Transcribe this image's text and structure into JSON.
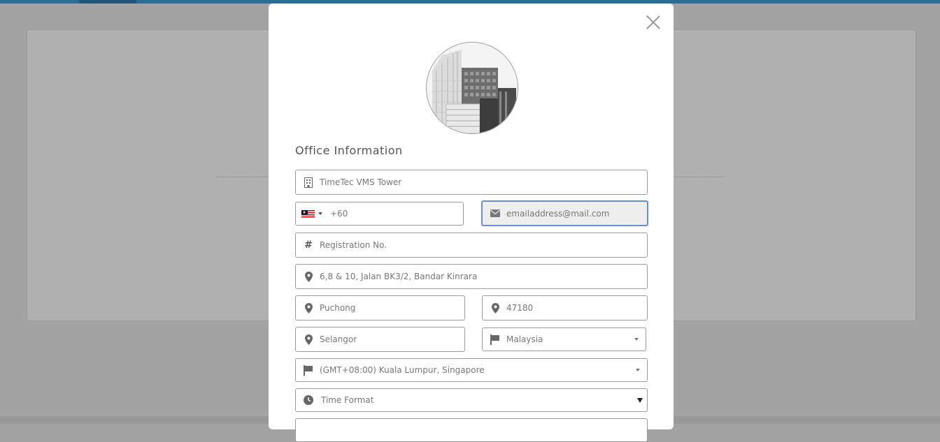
{
  "modal": {
    "section_title": "Office Information",
    "close_icon": "close-icon",
    "avatar_icon": "office-buildings-image"
  },
  "form": {
    "office_name": "TimeTec VMS Tower",
    "phone": {
      "country_flag": "malaysia-flag-icon",
      "code": "+60"
    },
    "email_placeholder": "emailaddress@mail.com",
    "registration_placeholder": "Registration No.",
    "address": "6,8 & 10, Jalan BK3/2, Bandar Kinrara",
    "city": "Puchong",
    "postcode": "47180",
    "state": "Selangor",
    "country": "Malaysia",
    "timezone": "(GMT+08:00) Kuala Lumpur, Singapore",
    "time_format_placeholder": "Time Format"
  },
  "colors": {
    "topbar": "#2a6d97",
    "focus_border": "#6a8fd0",
    "field_border": "#9a9a9a"
  }
}
